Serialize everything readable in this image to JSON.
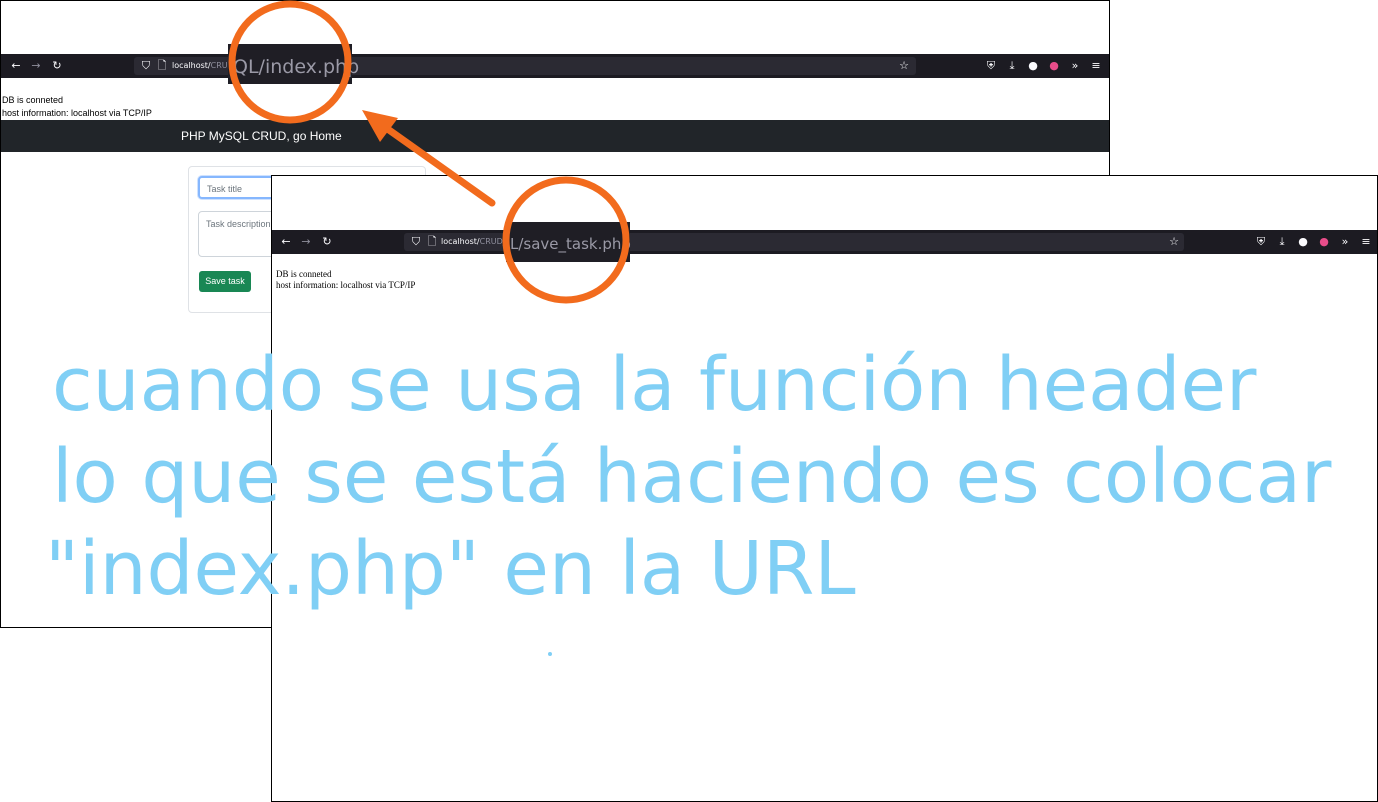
{
  "colors": {
    "toolbar_bg": "#1c1b22",
    "urlbar_bg": "#2b2a33",
    "navbar_bg": "#212529",
    "save_button_bg": "#198754",
    "annotation_orange": "#f26b1d",
    "handwriting_blue": "#80cff5"
  },
  "icons": {
    "back": "arrow-left-icon",
    "forward": "arrow-right-icon",
    "reload": "reload-icon",
    "shield": "shield-icon",
    "page": "page-icon",
    "star": "star-icon",
    "pocket": "pocket-icon",
    "download": "download-icon",
    "account": "account-icon",
    "extension": "color-wheel-icon",
    "overflow": "chevrons-icon",
    "menu": "hamburger-menu-icon"
  },
  "screen1": {
    "url_host": "localhost/",
    "url_path": "CRUD_",
    "zoom_url": "QL/index.php",
    "db_status": "DB is conneted",
    "host_info": "host information: localhost via TCP/IP",
    "navbar_brand": "PHP MySQL CRUD, go Home",
    "title_placeholder": "Task title",
    "description_placeholder": "Task description",
    "save_button": "Save task"
  },
  "screen2": {
    "url_host": "localhost/",
    "url_path": "CRUD_P",
    "zoom_url": "L/save_task.php",
    "db_status": "DB is conneted",
    "host_info": "host information: localhost via TCP/IP"
  },
  "annotation": {
    "line1": "cuando se usa la función header",
    "line2": "lo que se está haciendo es colocar",
    "line3": "\"index.php\" en la URL"
  }
}
